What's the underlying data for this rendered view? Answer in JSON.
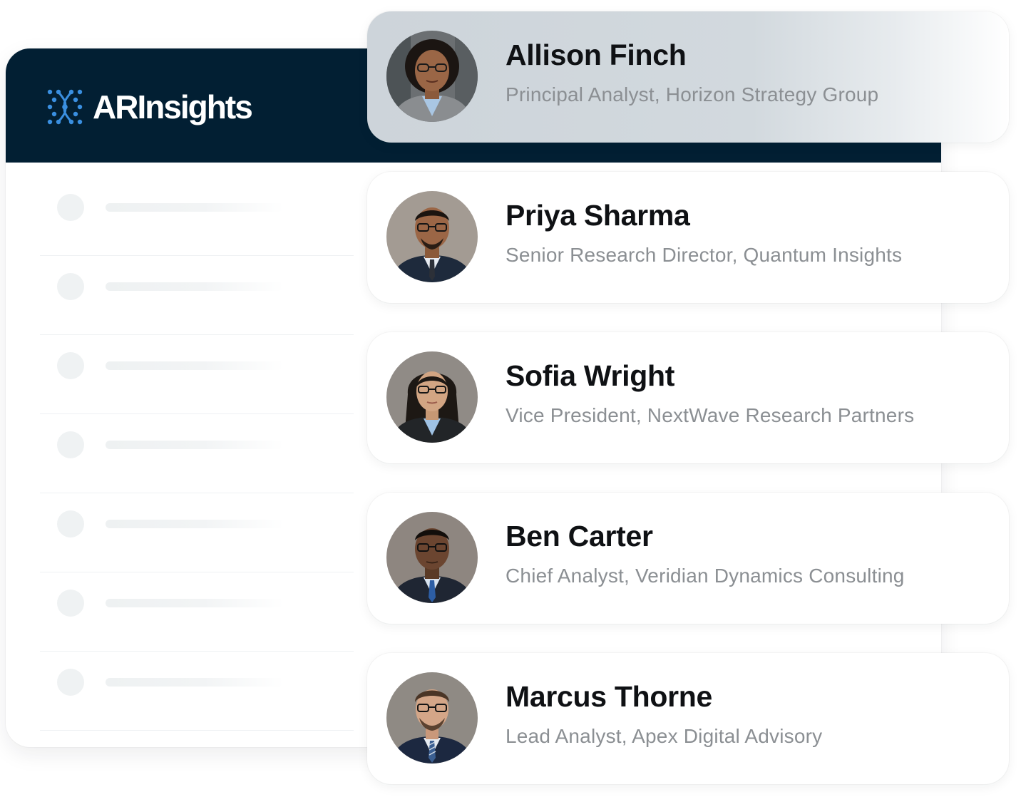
{
  "brand": {
    "name": "ARInsights",
    "icon": "dna-helix-grid-icon",
    "colors": {
      "header_bg": "#021f33",
      "logo_accent": "#3a8fe0"
    }
  },
  "skeleton_rows": 7,
  "analysts": [
    {
      "name": "Allison Finch",
      "title": "Principal Analyst, Horizon Strategy Group",
      "highlighted": true,
      "avatar": "avatar-photo-woman-curly-hair-glasses"
    },
    {
      "name": "Priya Sharma",
      "title": "Senior Research Director, Quantum Insights",
      "highlighted": false,
      "avatar": "avatar-photo-man-glasses-suit"
    },
    {
      "name": "Sofia Wright",
      "title": "Vice President, NextWave Research Partners",
      "highlighted": false,
      "avatar": "avatar-photo-woman-long-hair-glasses"
    },
    {
      "name": "Ben Carter",
      "title": "Chief Analyst, Veridian Dynamics Consulting",
      "highlighted": false,
      "avatar": "avatar-photo-man-glasses-blue-tie"
    },
    {
      "name": "Marcus Thorne",
      "title": "Lead Analyst, Apex Digital Advisory",
      "highlighted": false,
      "avatar": "avatar-photo-man-glasses-striped-tie"
    }
  ]
}
